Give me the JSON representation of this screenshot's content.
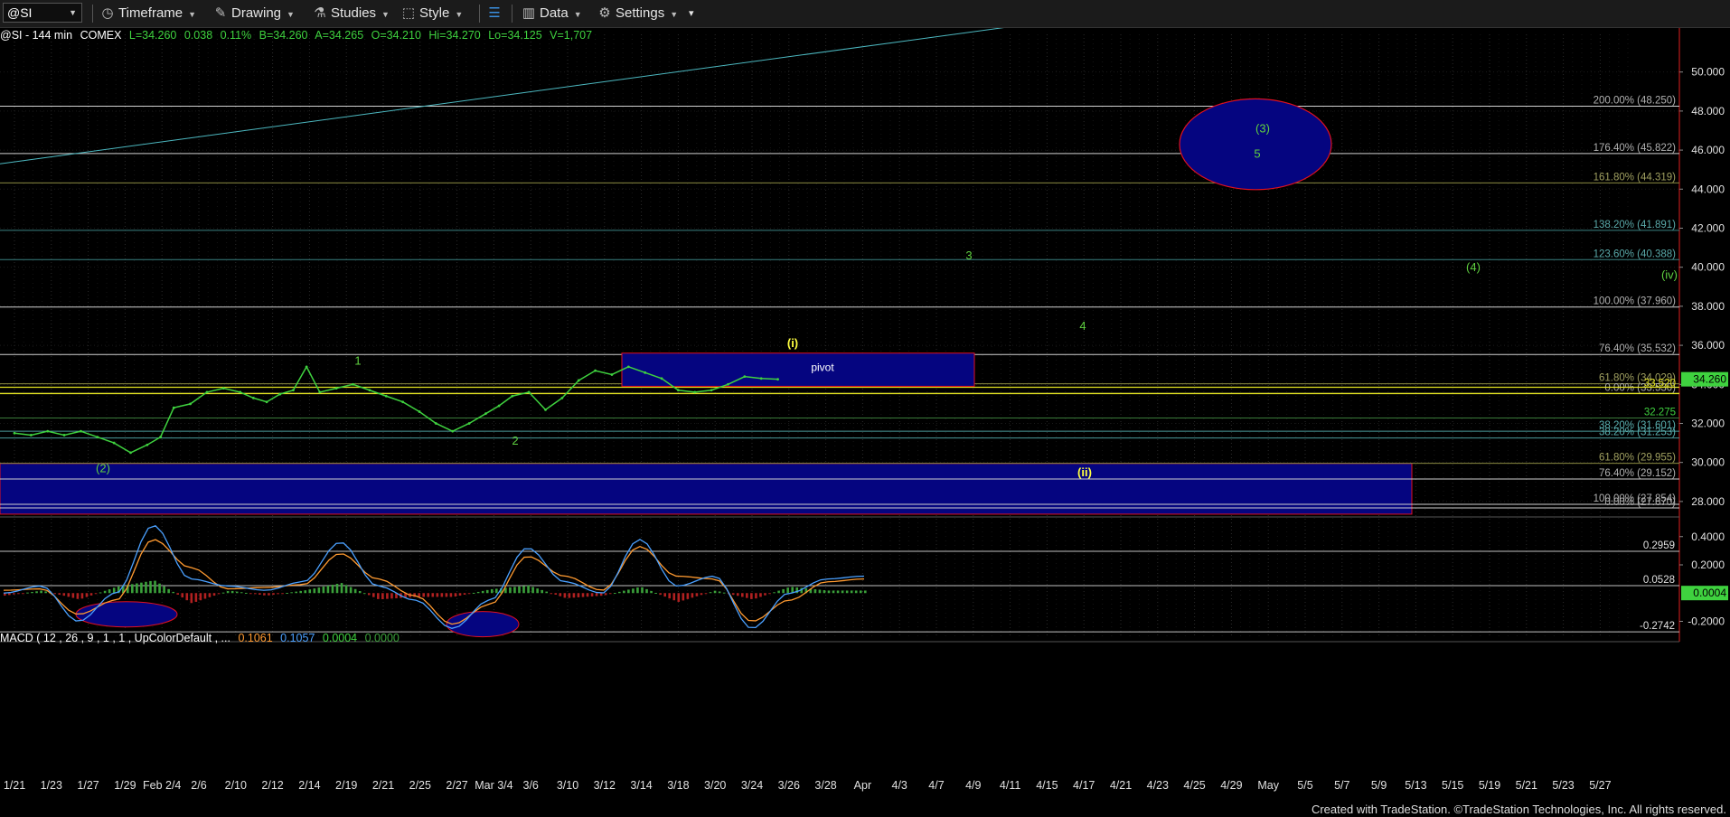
{
  "toolbar": {
    "symbol": "@SI",
    "buttons": [
      {
        "label": "Timeframe",
        "icon": "clock-icon"
      },
      {
        "label": "Drawing",
        "icon": "pencil-icon"
      },
      {
        "label": "Studies",
        "icon": "flask-icon"
      },
      {
        "label": "Style",
        "icon": "style-icon"
      },
      {
        "label": "",
        "icon": "layout-icon"
      },
      {
        "label": "Data",
        "icon": "bar-chart-icon"
      },
      {
        "label": "Settings",
        "icon": "gear-icon"
      }
    ]
  },
  "status": {
    "symbol": "@SI - 144 min",
    "exchange": "COMEX",
    "last": "L=34.260",
    "change": "0.038",
    "pct": "0.11%",
    "bid": "B=34.260",
    "ask": "A=34.265",
    "open": "O=34.210",
    "high": "Hi=34.270",
    "low": "Lo=34.125",
    "volume": "V=1,707"
  },
  "macd_legend": {
    "name": "MACD ( 12 , 26 , 9 , 1 , 1 , UpColorDefault , ...",
    "v1": "0.1061",
    "v2": "0.1057",
    "v3": "0.0004",
    "v4": "0.0000"
  },
  "footer": "Created with TradeStation. ©TradeStation Technologies, Inc. All rights reserved.",
  "colors": {
    "price": "#3fd23f",
    "grid": "#222222",
    "box": "#050580",
    "box_border": "#e01020",
    "wave_label": "#5fd040",
    "yellow_label": "#ffff40",
    "fib_text": "#c0c0c0",
    "trendline": "#4cb8c0",
    "macd_line": "#4aa0ff",
    "signal_line": "#ff9a30",
    "hist_up": "#3aa03a",
    "hist_down": "#b02020"
  },
  "chart_data": {
    "type": "line",
    "x_labels": [
      "1/21",
      "1/23",
      "1/27",
      "1/29",
      "Feb 2/4",
      "2/6",
      "2/10",
      "2/12",
      "2/14",
      "2/19",
      "2/21",
      "2/25",
      "2/27",
      "Mar 3/4",
      "3/6",
      "3/10",
      "3/12",
      "3/14",
      "3/18",
      "3/20",
      "3/24",
      "3/26",
      "3/28",
      "Apr",
      "4/3",
      "4/7",
      "4/9",
      "4/11",
      "4/15",
      "4/17",
      "4/21",
      "4/23",
      "4/25",
      "4/29",
      "May",
      "5/5",
      "5/7",
      "5/9",
      "5/13",
      "5/15",
      "5/19",
      "5/21",
      "5/23",
      "5/27"
    ],
    "price_axis": {
      "ticks": [
        "28.000",
        "30.000",
        "32.000",
        "34.000",
        "36.000",
        "38.000",
        "40.000",
        "42.000",
        "44.000",
        "46.000",
        "48.000",
        "50.000"
      ],
      "ylim": [
        27.3,
        52.3
      ]
    },
    "last_price": "34.260",
    "price_series": {
      "name": "@SI",
      "x": [
        0,
        0.5,
        1,
        1.5,
        2,
        2.5,
        3,
        3.5,
        4,
        4.4,
        4.8,
        5.3,
        5.8,
        6.3,
        6.8,
        7.2,
        7.6,
        8,
        8.4,
        8.8,
        9.2,
        9.7,
        10.2,
        10.7,
        11.2,
        11.7,
        12.2,
        12.7,
        13.2,
        13.7,
        14.2,
        14.6,
        15,
        15.5,
        16,
        16.5,
        17,
        17.5,
        18,
        18.5,
        19,
        19.5,
        20,
        20.5,
        21,
        21.5,
        22,
        22.5,
        23
      ],
      "y": [
        31.5,
        31.4,
        31.6,
        31.4,
        31.6,
        31.3,
        31.0,
        30.5,
        30.9,
        31.3,
        32.8,
        33.0,
        33.6,
        33.8,
        33.6,
        33.3,
        33.1,
        33.5,
        33.7,
        34.9,
        33.6,
        33.8,
        34.0,
        33.7,
        33.4,
        33.1,
        32.6,
        32.0,
        31.6,
        32.0,
        32.5,
        32.9,
        33.4,
        33.6,
        32.7,
        33.3,
        34.2,
        34.7,
        34.5,
        34.9,
        34.6,
        34.3,
        33.7,
        33.6,
        33.7,
        34.0,
        34.4,
        34.3,
        34.26
      ]
    },
    "fib_levels": [
      {
        "label": "200.00% (48.250)",
        "value": 48.25
      },
      {
        "label": "176.40% (45.822)",
        "value": 45.822
      },
      {
        "label": "161.80% (44.319)",
        "value": 44.319
      },
      {
        "label": "138.20% (41.891)",
        "value": 41.891
      },
      {
        "label": "123.60% (40.388)",
        "value": 40.388
      },
      {
        "label": "100.00% (37.960)",
        "value": 37.96
      },
      {
        "label": "76.40% (35.532)",
        "value": 35.532
      },
      {
        "label": "61.80% (34.029)",
        "value": 34.029
      },
      {
        "label": "0.00% (33.530)",
        "value": 33.53
      },
      {
        "label": "32.275",
        "value": 32.275
      },
      {
        "label": "38.20% (31.601)",
        "value": 31.601
      },
      {
        "label": "38.20% (31.253)",
        "value": 31.253
      },
      {
        "label": "61.80% (29.955)",
        "value": 29.955
      },
      {
        "label": "76.40% (29.152)",
        "value": 29.152
      },
      {
        "label": "100.00% (27.854)",
        "value": 27.854
      },
      {
        "label": "0.00% (27.670)",
        "value": 27.67
      }
    ],
    "support_price": "33.520",
    "wave_labels": [
      "1",
      "2",
      "(2)",
      "3",
      "4",
      "5",
      "(3)",
      "(4)",
      "(iv)",
      "(i)",
      "(ii)"
    ],
    "pivot_label": "pivot",
    "macd_axis": {
      "ticks": [
        "-0.2000",
        "0.2000",
        "0.4000"
      ],
      "ylim": [
        -0.28,
        0.52
      ]
    },
    "macd_levels": [
      {
        "label": "0.2959",
        "value": 0.2959
      },
      {
        "label": "0.0528",
        "value": 0.0528
      },
      {
        "label": "-0.2742",
        "value": -0.2742
      }
    ],
    "macd_last": "0.0004",
    "macd": {
      "x": [
        0,
        1,
        2,
        3,
        4,
        5,
        6,
        7,
        8,
        9,
        10,
        11,
        12,
        13,
        14,
        15,
        16,
        17,
        18,
        19,
        20,
        21,
        22,
        23
      ],
      "macd": [
        0.0,
        0.05,
        -0.2,
        0.0,
        0.48,
        0.1,
        0.05,
        0.02,
        0.08,
        0.36,
        0.05,
        -0.05,
        -0.25,
        -0.05,
        0.32,
        0.08,
        0.0,
        0.38,
        0.05,
        0.12,
        -0.25,
        0.0,
        0.1,
        0.12
      ],
      "signal": [
        0.02,
        0.03,
        -0.15,
        -0.05,
        0.38,
        0.18,
        0.03,
        0.04,
        0.06,
        0.28,
        0.1,
        -0.02,
        -0.22,
        -0.08,
        0.26,
        0.12,
        0.02,
        0.33,
        0.12,
        0.1,
        -0.2,
        -0.05,
        0.08,
        0.1
      ]
    }
  }
}
